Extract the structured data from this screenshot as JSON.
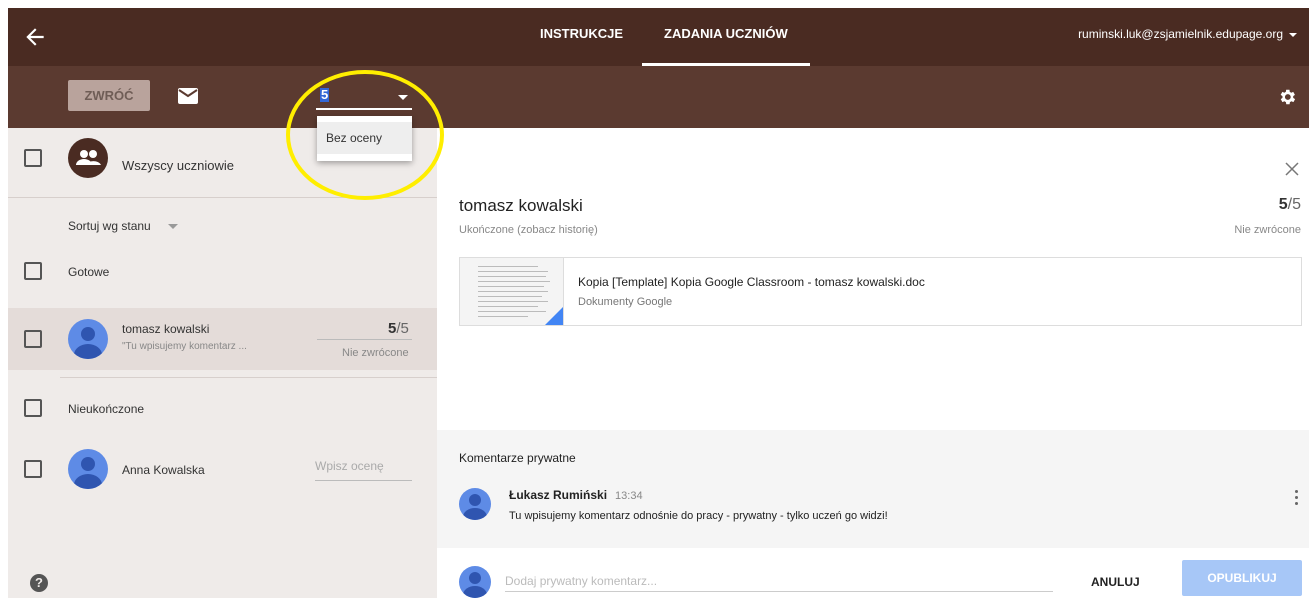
{
  "header": {
    "tabs": [
      {
        "label": "INSTRUKCJE"
      },
      {
        "label": "ZADANIA UCZNIÓW"
      }
    ],
    "account": "ruminski.luk@zsjamielnik.edupage.org"
  },
  "toolbar": {
    "return_label": "ZWRÓĆ",
    "grade_value": "5",
    "dropdown_option": "Bez oceny"
  },
  "left_panel": {
    "all_students_label": "Wszyscy uczniowie",
    "sort_label": "Sortuj wg stanu",
    "group_done": "Gotowe",
    "group_not_done": "Nieukończone",
    "students": [
      {
        "name": "tomasz kowalski",
        "comment_preview": "\"Tu wpisujemy komentarz ...",
        "score": "5",
        "max": "/5",
        "status": "Nie zwrócone"
      },
      {
        "name": "Anna Kowalska",
        "grade_placeholder": "Wpisz ocenę"
      }
    ],
    "help": "?"
  },
  "detail": {
    "student_name": "tomasz kowalski",
    "status": "Ukończone (zobacz historię)",
    "score": "5",
    "max": "/5",
    "return_status": "Nie zwrócone",
    "attachment": {
      "title": "Kopia [Template] Kopia Google Classroom - tomasz kowalski.doc",
      "type": "Dokumenty Google"
    },
    "comments": {
      "title": "Komentarze prywatne",
      "author": "Łukasz Rumiński",
      "time": "13:34",
      "text": "Tu wpisujemy komentarz odnośnie do pracy - prywatny - tylko uczeń go widzi!"
    },
    "new_comment_placeholder": "Dodaj prywatny komentarz...",
    "cancel_label": "ANULUJ",
    "publish_label": "OPUBLIKUJ"
  },
  "colors": {
    "header_bg": "#4a2b22",
    "toolbar_bg": "#5b3a30",
    "panel_bg": "#efebe9",
    "accent_blue": "#4285f4",
    "highlight": "#ffee00"
  }
}
